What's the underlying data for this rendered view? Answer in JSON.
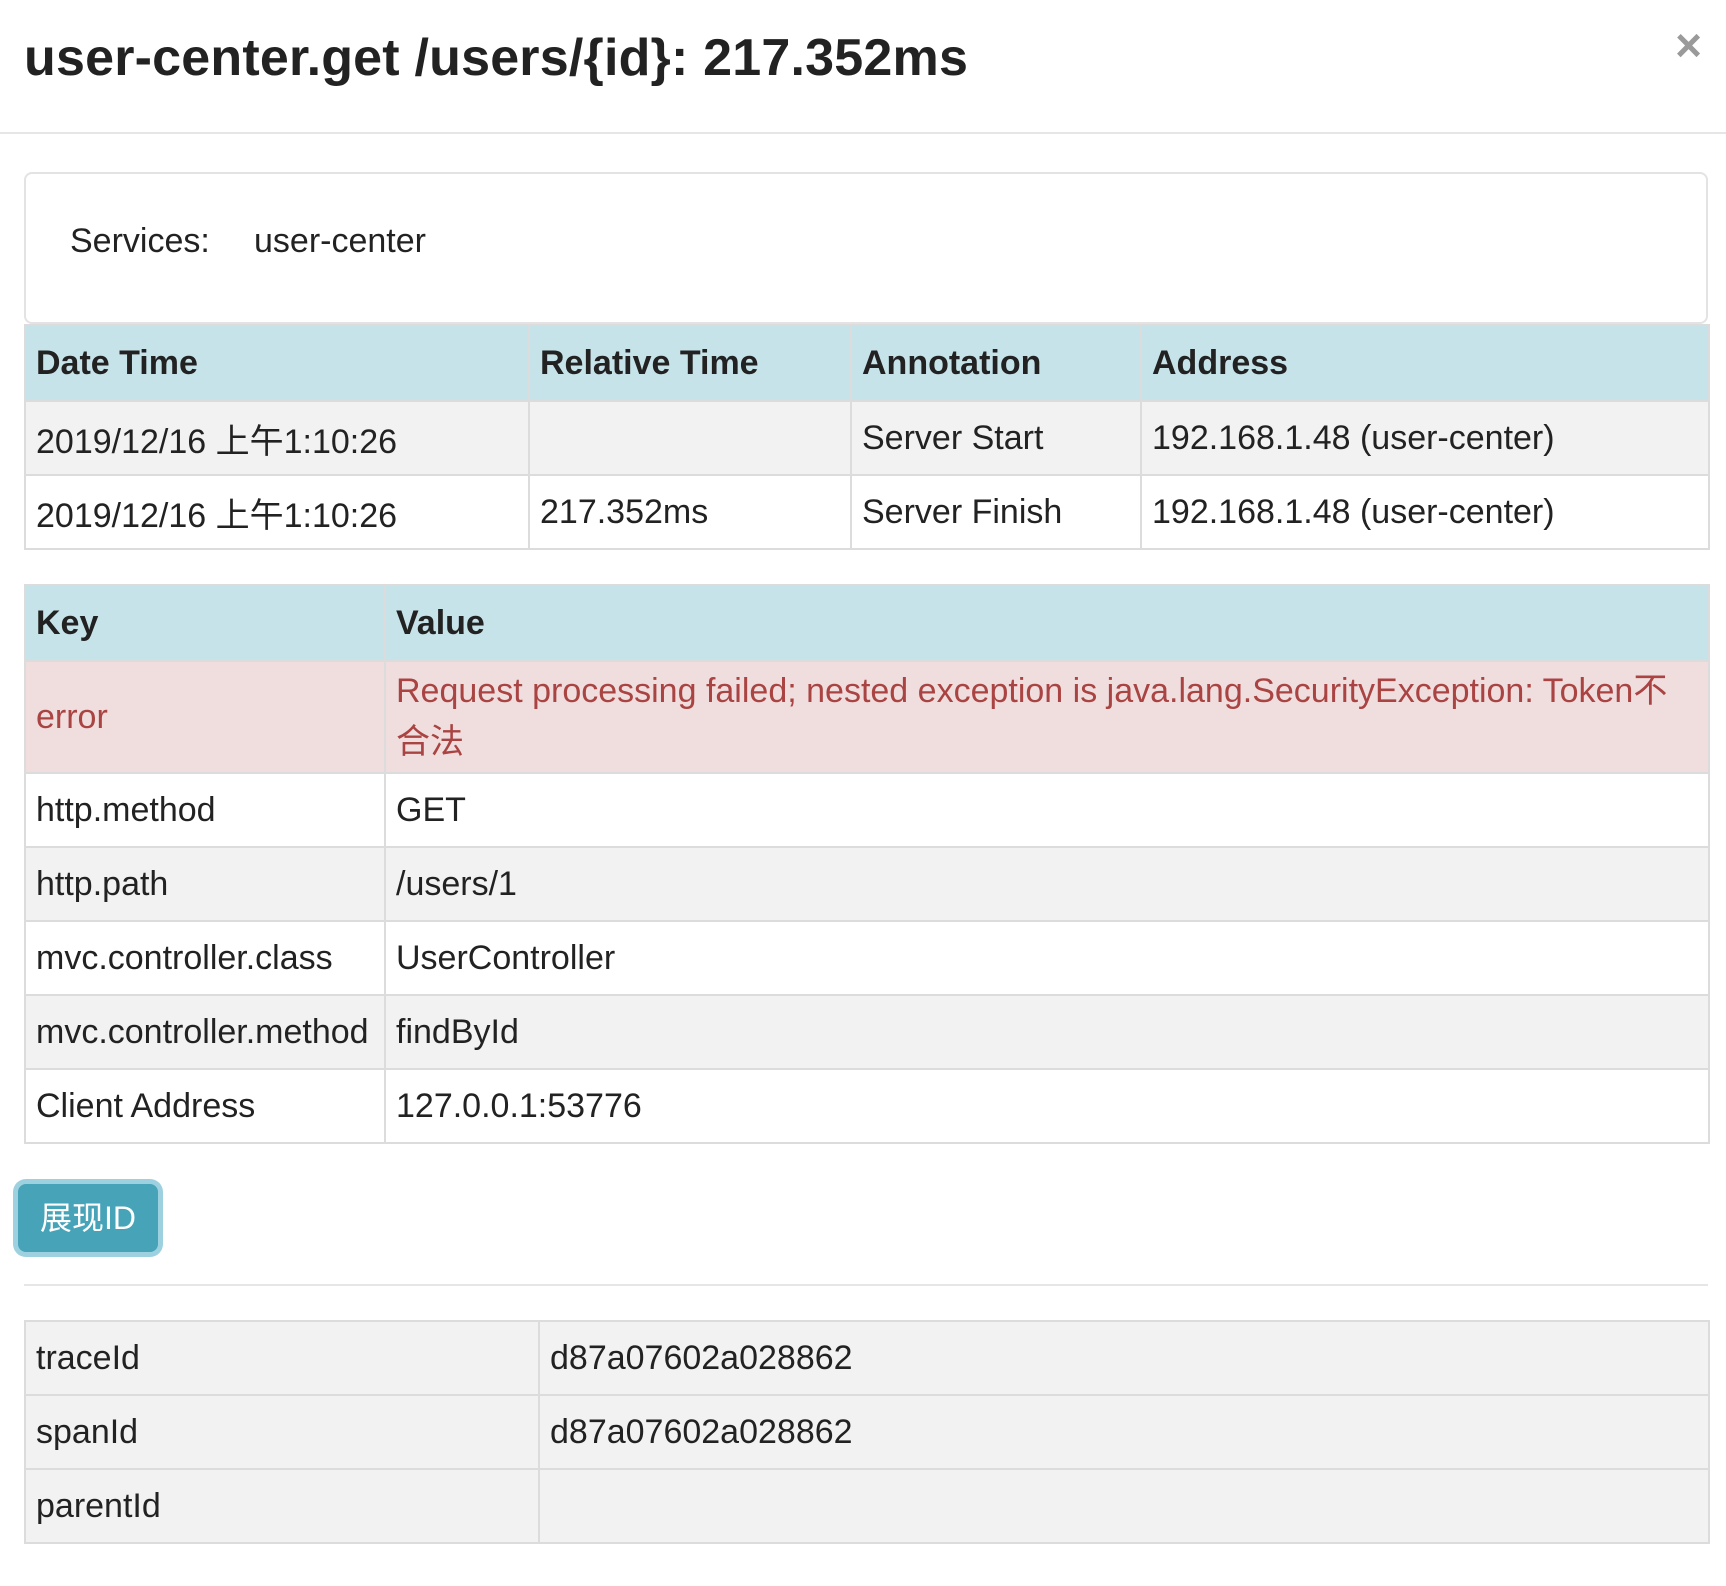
{
  "header": {
    "title": "user-center.get /users/{id}: 217.352ms",
    "close_symbol": "×"
  },
  "services": {
    "label": "Services:",
    "value": "user-center"
  },
  "annotations": {
    "columns": [
      "Date Time",
      "Relative Time",
      "Annotation",
      "Address"
    ],
    "rows": [
      [
        "2019/12/16 上午1:10:26",
        "",
        "Server Start",
        "192.168.1.48 (user-center)"
      ],
      [
        "2019/12/16 上午1:10:26",
        "217.352ms",
        "Server Finish",
        "192.168.1.48 (user-center)"
      ]
    ]
  },
  "tags": {
    "columns": [
      "Key",
      "Value"
    ],
    "rows": [
      [
        "error",
        "Request processing failed; nested exception is java.lang.SecurityException: Token不合法"
      ],
      [
        "http.method",
        "GET"
      ],
      [
        "http.path",
        "/users/1"
      ],
      [
        "mvc.controller.class",
        "UserController"
      ],
      [
        "mvc.controller.method",
        "findById"
      ],
      [
        "Client Address",
        "127.0.0.1:53776"
      ]
    ]
  },
  "show_id_button": {
    "label": "展现ID"
  },
  "ids": {
    "rows": [
      [
        "traceId",
        "d87a07602a028862"
      ],
      [
        "spanId",
        "d87a07602a028862"
      ],
      [
        "parentId",
        ""
      ]
    ]
  },
  "colors": {
    "header_row": "#c7e3ea",
    "danger_row": "#f0dedf",
    "danger_text": "#a94442",
    "button": "#46a3b8"
  }
}
